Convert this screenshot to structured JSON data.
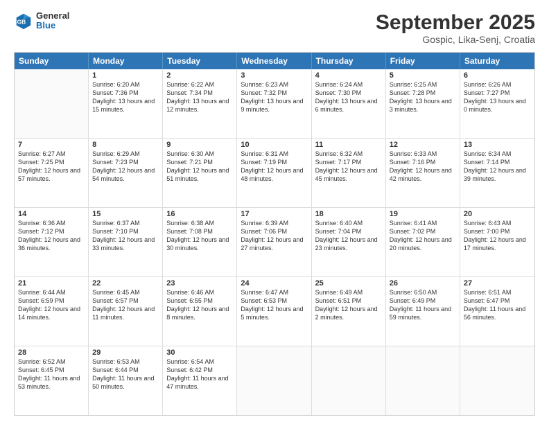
{
  "logo": {
    "general": "General",
    "blue": "Blue"
  },
  "title": "September 2025",
  "location": "Gospic, Lika-Senj, Croatia",
  "header_days": [
    "Sunday",
    "Monday",
    "Tuesday",
    "Wednesday",
    "Thursday",
    "Friday",
    "Saturday"
  ],
  "weeks": [
    [
      {
        "day": "",
        "sunrise": "",
        "sunset": "",
        "daylight": "",
        "empty": true
      },
      {
        "day": "1",
        "sunrise": "Sunrise: 6:20 AM",
        "sunset": "Sunset: 7:36 PM",
        "daylight": "Daylight: 13 hours and 15 minutes."
      },
      {
        "day": "2",
        "sunrise": "Sunrise: 6:22 AM",
        "sunset": "Sunset: 7:34 PM",
        "daylight": "Daylight: 13 hours and 12 minutes."
      },
      {
        "day": "3",
        "sunrise": "Sunrise: 6:23 AM",
        "sunset": "Sunset: 7:32 PM",
        "daylight": "Daylight: 13 hours and 9 minutes."
      },
      {
        "day": "4",
        "sunrise": "Sunrise: 6:24 AM",
        "sunset": "Sunset: 7:30 PM",
        "daylight": "Daylight: 13 hours and 6 minutes."
      },
      {
        "day": "5",
        "sunrise": "Sunrise: 6:25 AM",
        "sunset": "Sunset: 7:28 PM",
        "daylight": "Daylight: 13 hours and 3 minutes."
      },
      {
        "day": "6",
        "sunrise": "Sunrise: 6:26 AM",
        "sunset": "Sunset: 7:27 PM",
        "daylight": "Daylight: 13 hours and 0 minutes."
      }
    ],
    [
      {
        "day": "7",
        "sunrise": "Sunrise: 6:27 AM",
        "sunset": "Sunset: 7:25 PM",
        "daylight": "Daylight: 12 hours and 57 minutes."
      },
      {
        "day": "8",
        "sunrise": "Sunrise: 6:29 AM",
        "sunset": "Sunset: 7:23 PM",
        "daylight": "Daylight: 12 hours and 54 minutes."
      },
      {
        "day": "9",
        "sunrise": "Sunrise: 6:30 AM",
        "sunset": "Sunset: 7:21 PM",
        "daylight": "Daylight: 12 hours and 51 minutes."
      },
      {
        "day": "10",
        "sunrise": "Sunrise: 6:31 AM",
        "sunset": "Sunset: 7:19 PM",
        "daylight": "Daylight: 12 hours and 48 minutes."
      },
      {
        "day": "11",
        "sunrise": "Sunrise: 6:32 AM",
        "sunset": "Sunset: 7:17 PM",
        "daylight": "Daylight: 12 hours and 45 minutes."
      },
      {
        "day": "12",
        "sunrise": "Sunrise: 6:33 AM",
        "sunset": "Sunset: 7:16 PM",
        "daylight": "Daylight: 12 hours and 42 minutes."
      },
      {
        "day": "13",
        "sunrise": "Sunrise: 6:34 AM",
        "sunset": "Sunset: 7:14 PM",
        "daylight": "Daylight: 12 hours and 39 minutes."
      }
    ],
    [
      {
        "day": "14",
        "sunrise": "Sunrise: 6:36 AM",
        "sunset": "Sunset: 7:12 PM",
        "daylight": "Daylight: 12 hours and 36 minutes."
      },
      {
        "day": "15",
        "sunrise": "Sunrise: 6:37 AM",
        "sunset": "Sunset: 7:10 PM",
        "daylight": "Daylight: 12 hours and 33 minutes."
      },
      {
        "day": "16",
        "sunrise": "Sunrise: 6:38 AM",
        "sunset": "Sunset: 7:08 PM",
        "daylight": "Daylight: 12 hours and 30 minutes."
      },
      {
        "day": "17",
        "sunrise": "Sunrise: 6:39 AM",
        "sunset": "Sunset: 7:06 PM",
        "daylight": "Daylight: 12 hours and 27 minutes."
      },
      {
        "day": "18",
        "sunrise": "Sunrise: 6:40 AM",
        "sunset": "Sunset: 7:04 PM",
        "daylight": "Daylight: 12 hours and 23 minutes."
      },
      {
        "day": "19",
        "sunrise": "Sunrise: 6:41 AM",
        "sunset": "Sunset: 7:02 PM",
        "daylight": "Daylight: 12 hours and 20 minutes."
      },
      {
        "day": "20",
        "sunrise": "Sunrise: 6:43 AM",
        "sunset": "Sunset: 7:00 PM",
        "daylight": "Daylight: 12 hours and 17 minutes."
      }
    ],
    [
      {
        "day": "21",
        "sunrise": "Sunrise: 6:44 AM",
        "sunset": "Sunset: 6:59 PM",
        "daylight": "Daylight: 12 hours and 14 minutes."
      },
      {
        "day": "22",
        "sunrise": "Sunrise: 6:45 AM",
        "sunset": "Sunset: 6:57 PM",
        "daylight": "Daylight: 12 hours and 11 minutes."
      },
      {
        "day": "23",
        "sunrise": "Sunrise: 6:46 AM",
        "sunset": "Sunset: 6:55 PM",
        "daylight": "Daylight: 12 hours and 8 minutes."
      },
      {
        "day": "24",
        "sunrise": "Sunrise: 6:47 AM",
        "sunset": "Sunset: 6:53 PM",
        "daylight": "Daylight: 12 hours and 5 minutes."
      },
      {
        "day": "25",
        "sunrise": "Sunrise: 6:49 AM",
        "sunset": "Sunset: 6:51 PM",
        "daylight": "Daylight: 12 hours and 2 minutes."
      },
      {
        "day": "26",
        "sunrise": "Sunrise: 6:50 AM",
        "sunset": "Sunset: 6:49 PM",
        "daylight": "Daylight: 11 hours and 59 minutes."
      },
      {
        "day": "27",
        "sunrise": "Sunrise: 6:51 AM",
        "sunset": "Sunset: 6:47 PM",
        "daylight": "Daylight: 11 hours and 56 minutes."
      }
    ],
    [
      {
        "day": "28",
        "sunrise": "Sunrise: 6:52 AM",
        "sunset": "Sunset: 6:45 PM",
        "daylight": "Daylight: 11 hours and 53 minutes."
      },
      {
        "day": "29",
        "sunrise": "Sunrise: 6:53 AM",
        "sunset": "Sunset: 6:44 PM",
        "daylight": "Daylight: 11 hours and 50 minutes."
      },
      {
        "day": "30",
        "sunrise": "Sunrise: 6:54 AM",
        "sunset": "Sunset: 6:42 PM",
        "daylight": "Daylight: 11 hours and 47 minutes."
      },
      {
        "day": "",
        "sunrise": "",
        "sunset": "",
        "daylight": "",
        "empty": true
      },
      {
        "day": "",
        "sunrise": "",
        "sunset": "",
        "daylight": "",
        "empty": true
      },
      {
        "day": "",
        "sunrise": "",
        "sunset": "",
        "daylight": "",
        "empty": true
      },
      {
        "day": "",
        "sunrise": "",
        "sunset": "",
        "daylight": "",
        "empty": true
      }
    ]
  ]
}
